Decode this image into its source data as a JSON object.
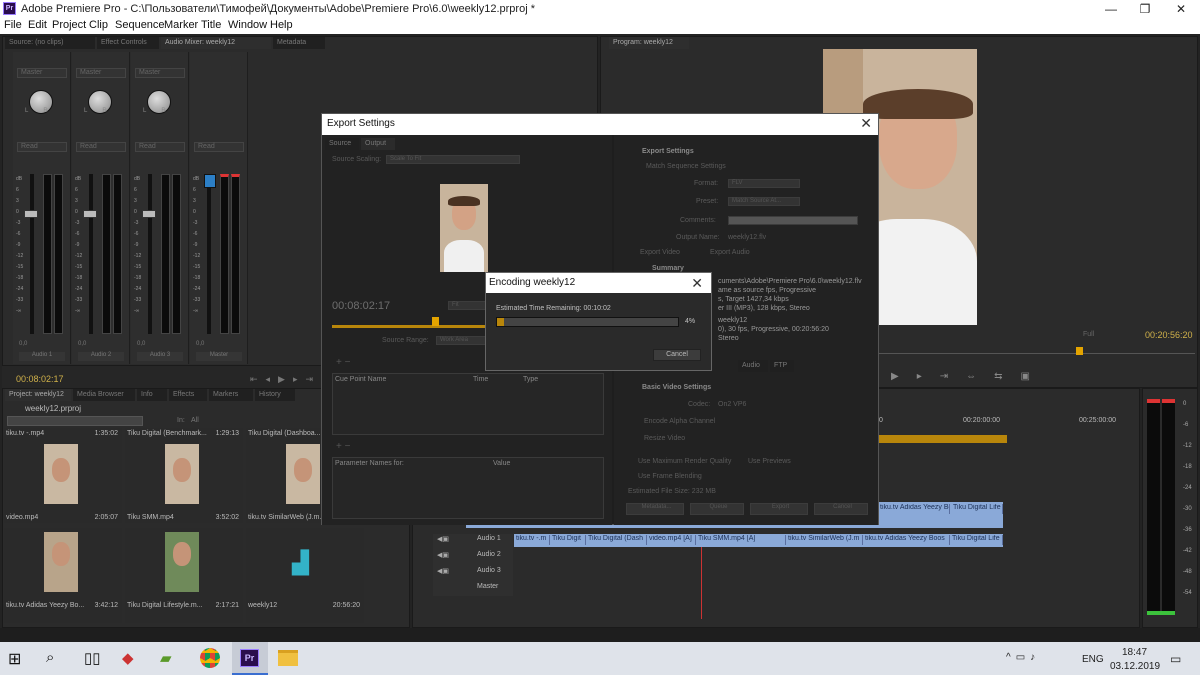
{
  "window": {
    "title": "Adobe Premiere Pro - C:\\Пользователи\\Тимофей\\Документы\\Adobe\\Premiere Pro\\6.0\\weekly12.prproj *",
    "app_icon": "Pr"
  },
  "menu": [
    "File",
    "Edit",
    "Project",
    "Clip",
    "Sequence",
    "Marker",
    "Title",
    "Window",
    "Help"
  ],
  "source_tabs": [
    "Source: (no clips)",
    "Effect Controls",
    "Audio Mixer: weekly12",
    "Metadata"
  ],
  "program_tab": "Program: weekly12",
  "mixer": {
    "channels": [
      {
        "mode": "Master",
        "read": "Read",
        "name": "Audio 1",
        "readout": "0,0"
      },
      {
        "mode": "Master",
        "read": "Read",
        "name": "Audio 2",
        "readout": "0,0"
      },
      {
        "mode": "Master",
        "read": "Read",
        "name": "Audio 3",
        "readout": "0,0"
      },
      {
        "mode": "",
        "read": "Read",
        "name": "Master",
        "readout": "0,0"
      }
    ],
    "scale_left": "dB\n6\n3\n0\n-3\n-6\n-9\n-12\n-15\n-18\n-24\n-33\n-∞",
    "scale_right": "6\n0\n-6\n-12\n-18\n-24\n-30\n-36\n-42\n-48\n-54\ndB",
    "timecode": "00:08:02:17",
    "peak": "-16,6"
  },
  "program": {
    "timecode": "00:20:56:20",
    "fit": "Full"
  },
  "project": {
    "tabs": [
      "Project: weekly12",
      "Media Browser",
      "Info",
      "Effects",
      "Markers",
      "History"
    ],
    "name": "weekly12.prproj",
    "in_label": "In:",
    "in_value": "All",
    "items": [
      {
        "name": "tiku.tv -.mp4",
        "duration": "1:35:02"
      },
      {
        "name": "Tiku Digital (Benchmark...",
        "duration": "1:29:13"
      },
      {
        "name": "Tiku Digital (Dashboa...",
        "duration": ""
      },
      {
        "name": "video.mp4",
        "duration": "2:05:07"
      },
      {
        "name": "Tiku SMM.mp4",
        "duration": "3:52:02"
      },
      {
        "name": "tiku.tv SimilarWeb (J.m...",
        "duration": ""
      },
      {
        "name": "tiku.tv Adidas Yeezy Bo...",
        "duration": "3:42:12"
      },
      {
        "name": "Tiku Digital Lifestyle.m...",
        "duration": "2:17:21"
      },
      {
        "name": "weekly12",
        "duration": "20:56:20"
      }
    ]
  },
  "timeline": {
    "ruler": [
      "0",
      "00:20:00:00",
      "00:25:00:00"
    ],
    "tracks": [
      "Audio 1",
      "Audio 2",
      "Audio 3",
      "Master"
    ],
    "video_clips": [
      "tiku.tv Adidas Yeezy Boos",
      "Tiku Digital Life"
    ],
    "audio_clips": [
      "tiku.tv -.m",
      "Tiku Digit",
      "Tiku Digital (Dash",
      "video.mp4 [A]",
      "Tiku SMM.mp4 [A]",
      "tiku.tv SimilarWeb (J.m",
      "tiku.tv Adidas Yeezy Boos",
      "Tiku Digital Life"
    ]
  },
  "meter_scale": [
    "0",
    "-6",
    "-12",
    "-18",
    "-24",
    "-30",
    "-36",
    "-42",
    "-48",
    "-54"
  ],
  "export_dialog": {
    "title": "Export Settings",
    "tabs": [
      "Source",
      "Output"
    ],
    "source_scaling_label": "Source Scaling:",
    "source_scaling_value": "Scale To Fit",
    "timecode": "00:08:02:17",
    "fit": "Fit",
    "source_range_label": "Source Range:",
    "source_range_value": "Work Area",
    "cue_headers": [
      "Cue Point Name",
      "Time",
      "Type"
    ],
    "param_headers": [
      "Parameter Names for:",
      "Value"
    ],
    "settings_heading": "Export Settings",
    "match_sequence": "Match Sequence Settings",
    "format_label": "Format:",
    "format_value": "FLV",
    "preset_label": "Preset:",
    "preset_value": "Match Source At...",
    "comments_label": "Comments:",
    "output_name_label": "Output Name:",
    "output_name_value": "weekly12.flv",
    "export_video": "Export Video",
    "export_audio": "Export Audio",
    "summary_heading": "Summary",
    "summary_lines": [
      "cuments\\Adobe\\Premiere Pro\\6.0\\weekly12.flv",
      "ame as source fps, Progressive",
      "s, Target 1427,34 kbps",
      "er III (MP3), 128 kbps, Stereo",
      "weekly12",
      "0), 30 fps, Progressive, 00:20:56:20",
      "Stereo"
    ],
    "sub_tabs": [
      "Audio",
      "FTP"
    ],
    "basic_video": "Basic Video Settings",
    "codec_label": "Codec:",
    "codec_value": "On2 VP6",
    "encode_alpha": "Encode Alpha Channel",
    "resize_video": "Resize Video",
    "max_render": "Use Maximum Render Quality",
    "use_previews": "Use Previews",
    "frame_blending": "Use Frame Blending",
    "file_size": "Estimated File Size: 232 MB",
    "buttons": [
      "Metadata...",
      "Queue",
      "Export",
      "Cancel"
    ]
  },
  "encoding_dialog": {
    "title": "Encoding weekly12",
    "remaining_label": "Estimated Time Remaining: 00:10:02",
    "progress": 0.04,
    "progress_text": "4%",
    "cancel": "Cancel"
  },
  "taskbar": {
    "lang": "ENG",
    "time": "18:47",
    "date": "03.12.2019",
    "icons": [
      "windows-icon",
      "search-icon",
      "task-view-icon",
      "app-icon",
      "bookmark-icon",
      "chrome-icon",
      "premiere-icon",
      "explorer-icon"
    ]
  }
}
